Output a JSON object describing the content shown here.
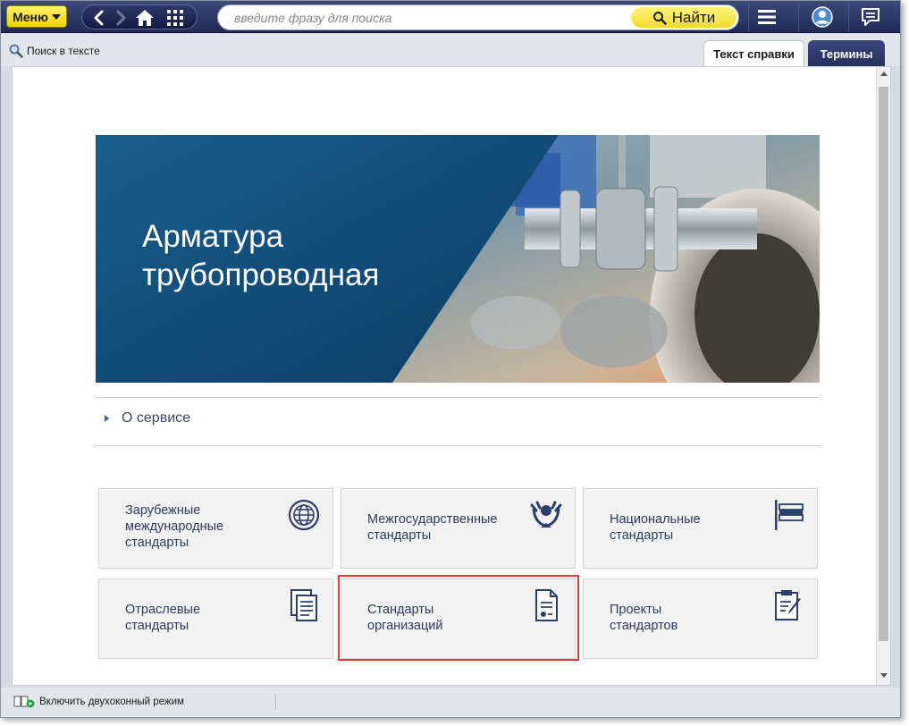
{
  "toolbar": {
    "menu_label": "Меню",
    "search_placeholder": "введите фразу для поиска",
    "find_label": "Найти",
    "icons": {
      "back": "chevron-left-icon",
      "forward": "chevron-right-icon",
      "home": "home-icon",
      "apps": "grid-icon",
      "hamburger": "menu-icon",
      "user": "user-icon",
      "feedback": "chat-icon"
    }
  },
  "subbar": {
    "text_search_label": "Поиск в тексте",
    "tabs": [
      {
        "label": "Текст справки",
        "active": true
      },
      {
        "label": "Термины",
        "active": false
      }
    ]
  },
  "banner": {
    "title": "Арматура трубопроводная"
  },
  "about": {
    "label": "О сервисе"
  },
  "tiles": [
    {
      "label": "Зарубежные\nмеждународные\nстандарты",
      "icon": "globe-icon"
    },
    {
      "label": "Межгосударственные\nстандарты",
      "icon": "cis-emblem-icon"
    },
    {
      "label": "Национальные\nстандарты",
      "icon": "flag-icon"
    },
    {
      "label": "Отраслевые\nстандарты",
      "icon": "documents-icon"
    },
    {
      "label": "Стандарты\nорганизаций",
      "icon": "certificate-icon"
    },
    {
      "label": "Проекты\nстандартов",
      "icon": "clipboard-edit-icon"
    }
  ],
  "statusbar": {
    "dual_mode_label": "Включить двухоконный режим"
  },
  "colors": {
    "toolbar_bg": "#26305c",
    "accent_yellow": "#f1d300",
    "banner_blue": "#0f4a7a",
    "tile_text": "#2f3d5e",
    "highlight": "#e23a3a"
  }
}
